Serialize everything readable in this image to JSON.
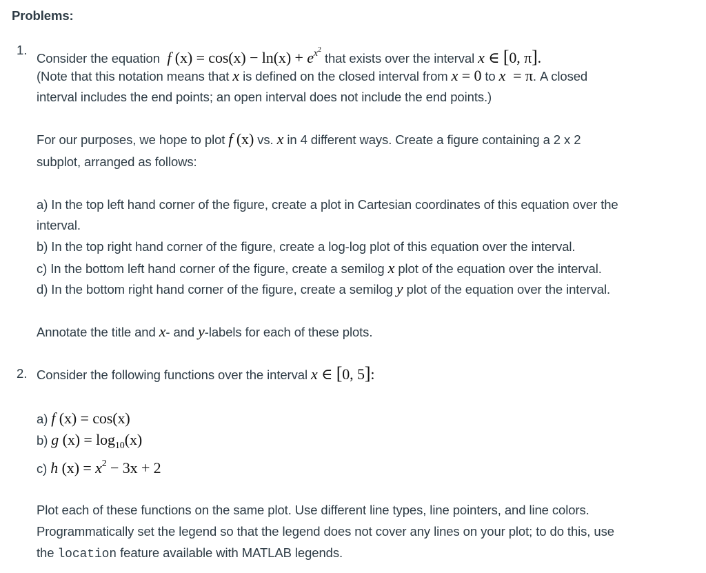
{
  "heading": "Problems:",
  "problem1": {
    "number": "1.",
    "intro": "Consider the equation",
    "equation": {
      "lhs_f": "f",
      "lhs_arg": "(x)",
      "eq": "=",
      "term1": "cos(x)",
      "minus": "−",
      "term2": "ln(x)",
      "plus": "+",
      "base": "e",
      "exp": "x",
      "exp_pow": "2"
    },
    "after_eq": "that exists over the interval",
    "interval": {
      "var": "x",
      "in": "∈",
      "open": "[",
      "values": "0, π",
      "close": "]",
      "end": "."
    },
    "note_line1_pre": "(Note that this notation means that",
    "note_var": "x",
    "note_line1_mid": "is defined on the closed interval from",
    "note_x1": "x",
    "note_eq1": "=",
    "note_v1": "0",
    "note_to": "to",
    "note_x2": "x",
    "note_eq2": "=",
    "note_v2": "π",
    "note_line1_end": ". A closed",
    "note_line2": "interval includes the end points; an open interval does not include the end points.)",
    "purpose_pre": "For our purposes, we hope to plot",
    "purpose_f": "f",
    "purpose_arg": "(x)",
    "purpose_vs": "vs.",
    "purpose_x": "x",
    "purpose_post": "in 4 different ways. Create a figure containing a 2 x 2",
    "purpose_line2": "subplot, arranged as follows:",
    "items": [
      {
        "line1": "a) In the top left hand corner of the figure, create a plot in Cartesian coordinates of this equation over the",
        "line2": "interval."
      },
      {
        "line1": "b) In the top right hand corner of the figure, create a log-log plot of this equation over the interval."
      },
      {
        "pre": "c) In the bottom left hand corner of the figure, create a semilog",
        "var": "x",
        "post": "plot of the equation over the interval."
      },
      {
        "pre": "d) In the bottom right hand corner of the figure, create a semilog",
        "var": "y",
        "post": "plot of the equation over the interval."
      }
    ],
    "annotate_pre": "Annotate the title and",
    "annotate_x": "x",
    "annotate_mid": "- and",
    "annotate_y": "y",
    "annotate_post": "-labels for each of these plots."
  },
  "problem2": {
    "number": "2.",
    "intro": "Consider the following functions over the interval",
    "interval": {
      "var": "x",
      "in": "∈",
      "open": "[",
      "values": "0, 5",
      "close": "]",
      "end": ":"
    },
    "functions": [
      {
        "label": "a)",
        "name": "f",
        "arg": "(x)",
        "eq": "=",
        "rhs": "cos(x)"
      },
      {
        "label": "b)",
        "name": "g",
        "arg": "(x)",
        "eq": "=",
        "rhs_fn": "log",
        "rhs_sub": "10",
        "rhs_arg": "(x)"
      },
      {
        "label": "c)",
        "name": "h",
        "arg": "(x)",
        "eq": "=",
        "rhs_x": "x",
        "rhs_pow": "2",
        "rhs_rest": "− 3x + 2"
      }
    ],
    "instr_line1": "Plot each of these functions on the same plot. Use different line types, line pointers, and line colors.",
    "instr_line2": "Programmatically set the legend so that the legend does not cover any lines on your plot; to do this, use",
    "instr_line3_pre": "the",
    "instr_code": "location",
    "instr_line3_post": "feature available with MATLAB legends."
  }
}
